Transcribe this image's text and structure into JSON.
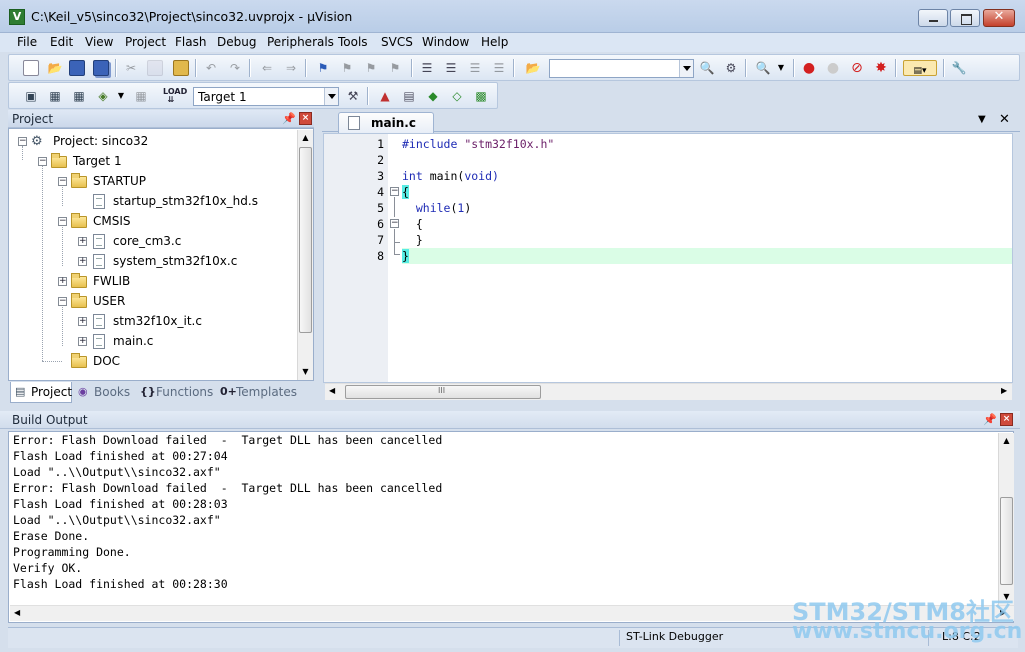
{
  "window": {
    "title": "C:\\Keil_v5\\sinco32\\Project\\sinco32.uvprojx - µVision",
    "close_glyph": "✕",
    "app_icon": "V"
  },
  "menu": [
    "File",
    "Edit",
    "View",
    "Project",
    "Flash",
    "Debug",
    "Peripherals",
    "Tools",
    "SVCS",
    "Window",
    "Help"
  ],
  "toolbar": {
    "find_combo_value": "",
    "target_combo_value": "Target 1"
  },
  "project_panel": {
    "title": "Project",
    "tree": {
      "root": "Project: sinco32",
      "target": "Target 1",
      "groups": [
        {
          "name": "STARTUP",
          "files": [
            "startup_stm32f10x_hd.s"
          ]
        },
        {
          "name": "CMSIS",
          "files": [
            "core_cm3.c",
            "system_stm32f10x.c"
          ]
        },
        {
          "name": "FWLIB",
          "files": []
        },
        {
          "name": "USER",
          "files": [
            "stm32f10x_it.c",
            "main.c"
          ]
        },
        {
          "name": "DOC",
          "files": []
        }
      ]
    },
    "tabs": [
      "Project",
      "Books",
      "Functions",
      "Templates"
    ]
  },
  "editor": {
    "tab_label": "main.c",
    "lines": [
      {
        "n": "1",
        "text": "#include \"stm32f10x.h\""
      },
      {
        "n": "2",
        "text": ""
      },
      {
        "n": "3",
        "text": "int main(void)"
      },
      {
        "n": "4",
        "text": "{"
      },
      {
        "n": "5",
        "text": "  while(1)"
      },
      {
        "n": "6",
        "text": "  {"
      },
      {
        "n": "7",
        "text": "  }"
      },
      {
        "n": "8",
        "text": "}"
      }
    ],
    "scroll_thumb_glyph": "III"
  },
  "build_output": {
    "title": "Build Output",
    "lines": [
      "Error: Flash Download failed  -  Target DLL has been cancelled",
      "Flash Load finished at 00:27:04",
      "Load \"..\\\\Output\\\\sinco32.axf\"",
      "Error: Flash Download failed  -  Target DLL has been cancelled",
      "Flash Load finished at 00:28:03",
      "Load \"..\\\\Output\\\\sinco32.axf\"",
      "Erase Done.",
      "Programming Done.",
      "Verify OK.",
      "Flash Load finished at 00:28:30"
    ]
  },
  "status": {
    "debugger": "ST-Link Debugger",
    "position": "L:8 C:2"
  },
  "watermark": {
    "line1": "STM32/STM8社区",
    "line2": "www.stmcu.org.cn"
  },
  "colors": {
    "keyword": "#1f2cb5",
    "string": "#6b1f68",
    "current_line": "#dafde6",
    "brace_match": "#59ede4"
  }
}
